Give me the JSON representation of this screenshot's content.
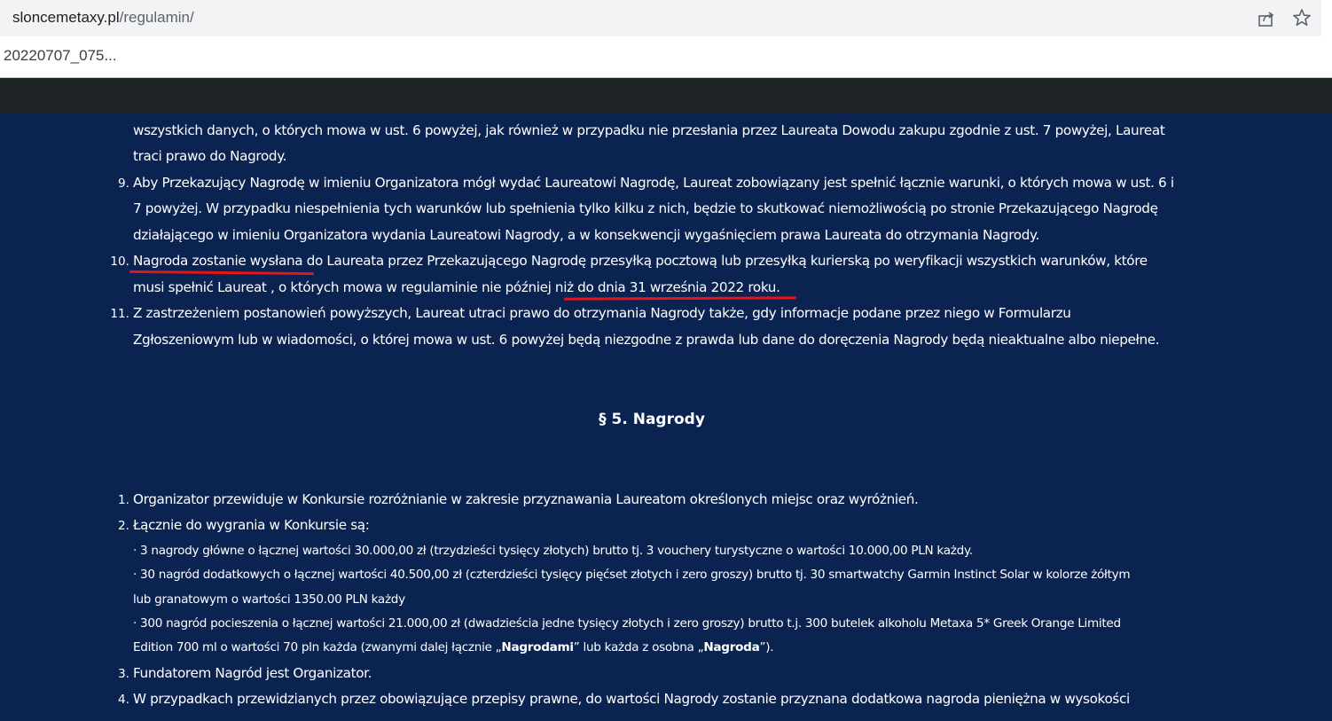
{
  "browser": {
    "url_domain": "sloncemetaxy.pl",
    "url_path": "/regulamin/",
    "download_item": "20220707_075..."
  },
  "section4_tail": {
    "line1": "wszystkich danych, o których mowa w ust. 6 powyżej, jak również w przypadku nie przesłania przez Laureata Dowodu zakupu zgodnie z ust. 7 powyżej, Laureat",
    "line2": "traci prawo do Nagrody.",
    "item9": {
      "num": "9.",
      "line1": "Aby Przekazujący Nagrodę w imieniu Organizatora mógł wydać Laureatowi Nagrodę, Laureat zobowiązany jest spełnić łącznie warunki, o których mowa w ust. 6 i",
      "line2": "7 powyżej. W przypadku niespełnienia tych warunków lub spełnienia tylko kilku z nich, będzie to skutkować niemożliwością po stronie Przekazującego Nagrodę",
      "line3": "działającego w imieniu Organizatora wydania Laureatowi Nagrody, a w konsekwencji wygaśnięciem prawa Laureata do otrzymania Nagrody."
    },
    "item10": {
      "num": "10.",
      "line1": "Nagroda zostanie wysłana do Laureata przez Przekazującego Nagrodę przesyłką pocztową lub przesyłką kurierską po weryfikacji wszystkich warunków, które",
      "line2": "musi spełnić Laureat , o których mowa w regulaminie nie później niż do dnia 31 września 2022 roku."
    },
    "item11": {
      "num": "11.",
      "line1": "Z zastrzeżeniem postanowień powyższych, Laureat utraci prawo do otrzymania Nagrody także, gdy informacje podane przez niego w Formularzu",
      "line2": "Zgłoszeniowym lub w wiadomości, o której mowa w ust. 6 powyżej będą niezgodne z prawda lub dane do doręczenia Nagrody będą nieaktualne albo niepełne."
    }
  },
  "section5": {
    "heading": "§ 5. Nagrody",
    "item1": {
      "num": "1.",
      "text": "Organizator przewiduje w Konkursie rozróżnianie w zakresie przyznawania Laureatom określonych miejsc oraz wyróżnień."
    },
    "item2": {
      "num": "2.",
      "text": "Łącznie do wygrania w Konkursie są:",
      "sub1": "· 3 nagrody główne o łącznej wartości 30.000,00 zł (trzydzieści tysięcy złotych) brutto tj. 3 vouchery turystyczne o wartości 10.000,00 PLN każdy.",
      "sub2_line1": "· 30 nagród dodatkowych o łącznej wartości 40.500,00 zł (czterdzieści tysięcy pięćset złotych i zero groszy) brutto tj. 30 smartwatchy Garmin Instinct Solar w kolorze żółtym",
      "sub2_line2": "lub granatowym o wartości 1350.00 PLN każdy",
      "sub3_line1": "· 300 nagród pocieszenia o łącznej wartości 21.000,00 zł (dwadzieścia jedne tysięcy złotych i zero groszy) brutto t.j. 300 butelek alkoholu Metaxa 5* Greek Orange Limited",
      "sub3_line2_a": "Edition 700 ml o wartości 70 pln każda (zwanymi dalej łącznie „",
      "sub3_line2_b": "Nagrodami",
      "sub3_line2_c": "” lub każda z osobna „",
      "sub3_line2_d": "Nagroda",
      "sub3_line2_e": "”)."
    },
    "item3": {
      "num": "3.",
      "text": "Fundatorem Nagród jest Organizator."
    },
    "item4": {
      "num": "4.",
      "text": "W przypadkach przewidzianych przez obowiązujące przepisy prawne, do wartości Nagrody zostanie przyznana dodatkowa nagroda pieniężna w wysokości"
    }
  },
  "colors": {
    "page_background": "#0a2351",
    "header_bar": "#1e2326",
    "annotation_underline": "#e8141b"
  },
  "icons": [
    "share-icon",
    "bookmark-star-icon"
  ]
}
